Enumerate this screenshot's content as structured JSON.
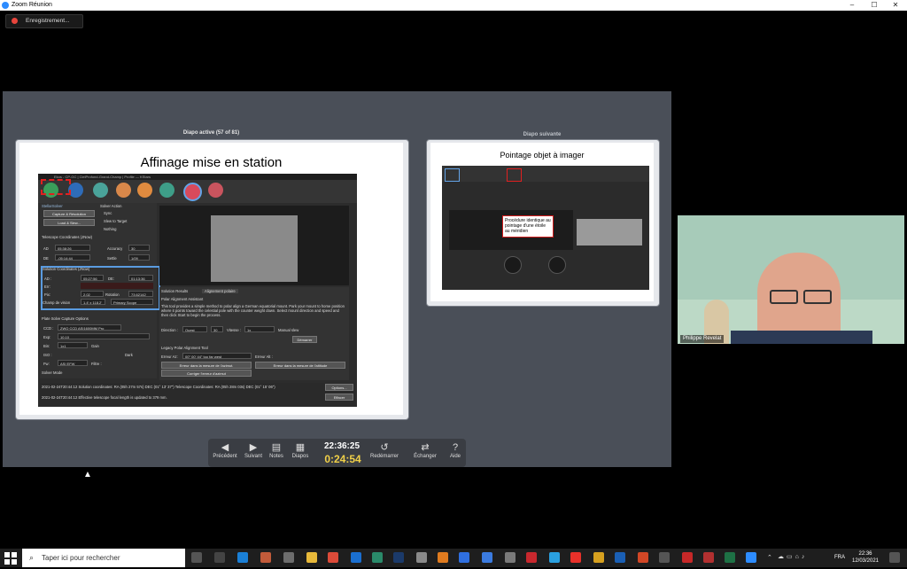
{
  "window": {
    "title": "Zoom Réunion",
    "controls": [
      "–",
      "☐",
      "✕"
    ]
  },
  "recording": {
    "label": "Enregistrement..."
  },
  "presenter": {
    "current_title": "Diapo active (57 of 81)",
    "next_title": "Diapo suivante",
    "current_slide_heading": "Affinage mise en station",
    "next_slide_heading": "Pointage objet à imager",
    "next_slide_note": "Procédure identique au pointage d'une étoile au méridien"
  },
  "kstars": {
    "window_title": "Ekos - CP-GC | CielProfond-Grand-Champ | Profile — KStars",
    "stellarsolver": "StellarSolver",
    "solver_action": "Solver Action",
    "capture_btn": "Capture & Résolution",
    "load_btn": "Load & Slew...",
    "radio_sync": "Sync",
    "radio_slew": "Slew to Target",
    "radio_nothing": "Nothing",
    "telescope_coords": "Telescope Coordinates (JNow)",
    "ad_label": "AD",
    "ad_value": "05:38:26",
    "accuracy_label": "Accuracy",
    "accuracy_value": "30",
    "de_label": "DE",
    "de_value": "-05:14:44",
    "settle_label": "Settle",
    "settle_value": "1/09",
    "solution_coords": "Solution Coordinates (JNow)",
    "sol_ad_label": "AD :",
    "sol_ad_value": "05:27:56",
    "sol_de_label": "DE:",
    "sol_de_value": "01:13:36",
    "err_label": "Err:",
    "pix_label": "Pix:",
    "pix_value": "2.02",
    "rotation_label": "Rotation",
    "rotation_value": "73.62142",
    "fov_label": "Champ de vision",
    "fov_value": "1.4' x 118.2'",
    "scope_value": "Primary Scope",
    "plate_solve": "Plate Solve Capture Options",
    "ccd_label": "CCD :",
    "ccd_value": "ZWO CCD ASI1600MM Pro",
    "exp_label": "Exp:",
    "exp_value": "10.10",
    "bin_label": "Bin:",
    "bin_value": "1x1",
    "gain_label": "Gain",
    "iso_label": "ISO :",
    "dark_label": "Dark",
    "fw_label": "Fw:",
    "fw_value": "ASI EFW",
    "filter_label": "Filtre :",
    "solver_mode": "Solver Mode",
    "tab_results": "Solution Results",
    "tab_polar": "Alignement polaire",
    "polar_assistant": "Polar Alignment Assistant",
    "polar_text": "This tool provides a simple method to polar align a German equatorial mount. Park your mount to home position where it points toward the celestial pole with the counter weight down. Select mount direction and speed and then click Start to begin the process.",
    "direction_label": "Direction :",
    "direction_value": "Ouest",
    "speed_value": "30",
    "vitesse_label": "Vitesse :",
    "vitesse_value": "1x",
    "manual_slew": "Manual slew",
    "demarrer": "Démarrer",
    "legacy": "Legacy Polar Alignment Tool",
    "erreur_az_label": "Erreur Az:",
    "erreur_az_value": "00° 00' 44\" too far west",
    "erreur_alt_label": "Erreur Alt :",
    "btn_azimut": "Erreur dans la mesure de l'azimut.",
    "btn_altitude": "Erreur dans la mesure de l'altitude",
    "btn_corriger": "Corriger l'erreur d'azimut",
    "log1": "2021-02-24T20:44:12 Solution coordinates: RA (05h 27m 57s) DEC (01° 13' 37\") Telescope Coordinates: RA (05h 28m 03s) DEC (01° 15' 06\")",
    "log2": "2021-02-24T20:44:12 Effective telescope focal length is updated to 379 mm.",
    "options_btn": "Options...",
    "effacer_btn": "Effacer"
  },
  "controls": {
    "prev": "Précédent",
    "next": "Suivant",
    "notes": "Notes",
    "slides": "Diapos",
    "clock": "22:36:25",
    "timer": "0:24:54",
    "restart": "Redémarrer",
    "swap": "Échanger",
    "help": "Aide"
  },
  "participant": {
    "name": "Philippe Revelat"
  },
  "taskbar": {
    "search_placeholder": "Taper ici pour rechercher",
    "lang": "FRA",
    "time": "22:36",
    "date": "12/03/2021"
  }
}
